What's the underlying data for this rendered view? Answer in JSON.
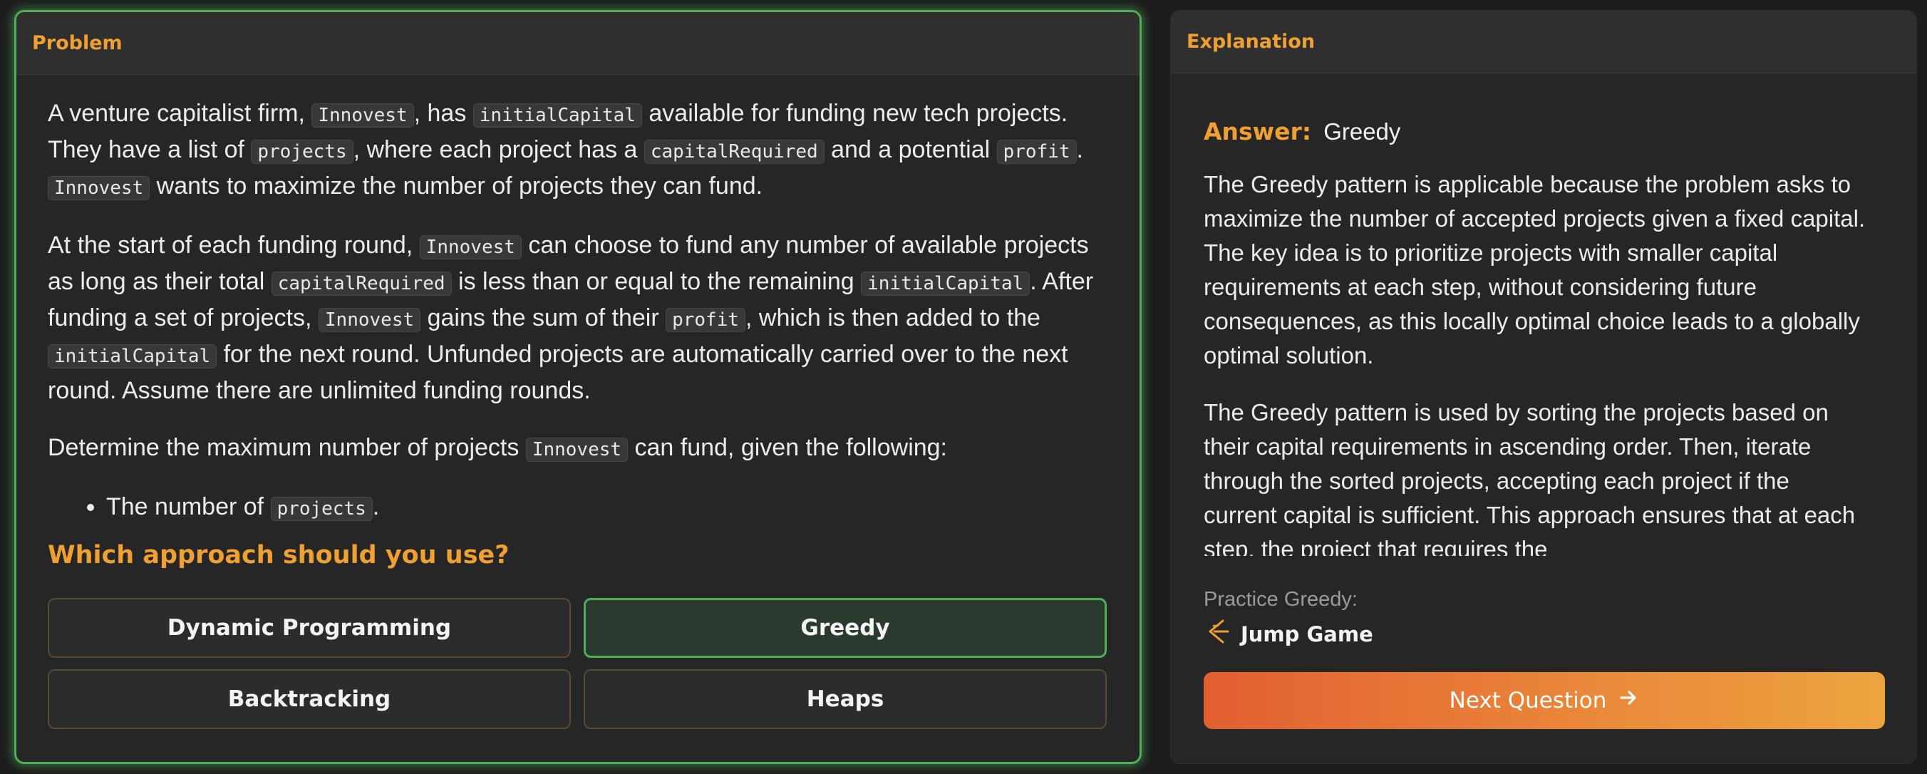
{
  "problem": {
    "header": "Problem",
    "paragraph1": {
      "t1": "A venture capitalist firm, ",
      "c1": "Innovest",
      "t2": ", has ",
      "c2": "initialCapital",
      "t3": " available for funding new tech projects. They have a list of ",
      "c3": "projects",
      "t4": ", where each project has a ",
      "c4": "capitalRequired",
      "t5": " and a potential ",
      "c5": "profit",
      "t6": ". ",
      "c6": "Innovest",
      "t7": " wants to maximize the number of projects they can fund."
    },
    "paragraph2": {
      "t1": "At the start of each funding round, ",
      "c1": "Innovest",
      "t2": " can choose to fund any number of available projects as long as their total ",
      "c2": "capitalRequired",
      "t3": " is less than or equal to the remaining ",
      "c3": "initialCapital",
      "t4": ". After funding a set of projects, ",
      "c4": "Innovest",
      "t5": " gains the sum of their ",
      "c5": "profit",
      "t6": ", which is then added to the ",
      "c6": "initialCapital",
      "t7": " for the next round. Unfunded projects are automatically carried over to the next round. Assume there are unlimited funding rounds."
    },
    "paragraph3": {
      "t1": "Determine the maximum number of projects ",
      "c1": "Innovest",
      "t2": " can fund, given the following:"
    },
    "bullets": [
      {
        "t1": "The number of ",
        "c1": "projects",
        "t2": "."
      }
    ]
  },
  "question": {
    "prompt": "Which approach should you use?",
    "options": [
      {
        "label": "Dynamic Programming",
        "selected": false
      },
      {
        "label": "Greedy",
        "selected": true
      },
      {
        "label": "Backtracking",
        "selected": false
      },
      {
        "label": "Heaps",
        "selected": false
      }
    ]
  },
  "explanation": {
    "header": "Explanation",
    "answer_label": "Answer:",
    "answer_value": "Greedy",
    "paragraphs": [
      "The Greedy pattern is applicable because the problem asks to maximize the number of accepted projects given a fixed capital. The key idea is to prioritize projects with smaller capital requirements at each step, without considering future consequences, as this locally optimal choice leads to a globally optimal solution.",
      "The Greedy pattern is used by sorting the projects based on their capital requirements in ascending order. Then, iterate through the sorted projects, accepting each project if the current capital is sufficient. This approach ensures that at each step, the project that requires the"
    ],
    "practice_label": "Practice Greedy:",
    "practice_link": "Jump Game",
    "practice_icon": "greedy-pattern-icon",
    "next_button": "Next Question",
    "next_icon": "arrow-right-icon"
  },
  "colors": {
    "accent_orange": "#f0a032",
    "selected_green": "#4fae58",
    "button_gradient_start": "#e35f31",
    "button_gradient_end": "#eda43f"
  }
}
